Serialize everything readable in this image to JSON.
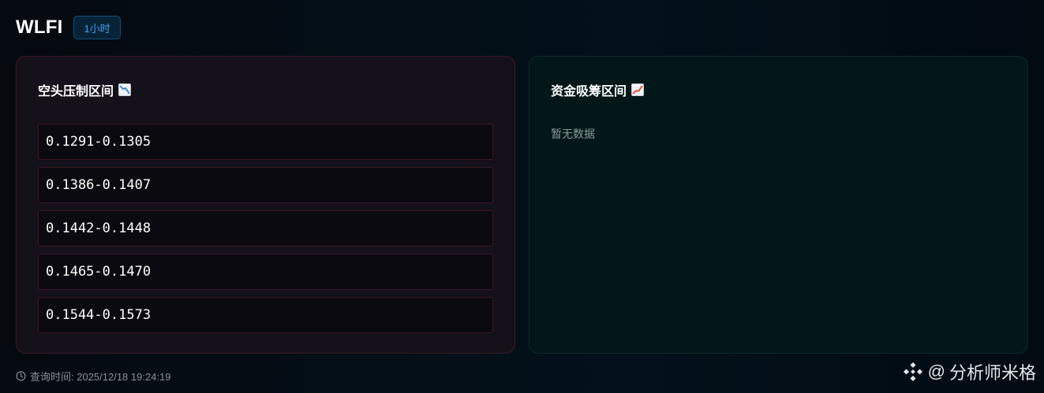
{
  "header": {
    "symbol": "WLFI",
    "timeframe": "1小时"
  },
  "short_zone": {
    "title": "空头压制区间",
    "icon": "chart-decreasing-icon",
    "ranges": [
      "0.1291-0.1305",
      "0.1386-0.1407",
      "0.1442-0.1448",
      "0.1465-0.1470",
      "0.1544-0.1573"
    ]
  },
  "long_zone": {
    "title": "资金吸筹区间",
    "icon": "chart-increasing-icon",
    "empty_text": "暂无数据"
  },
  "footer": {
    "query_time": "查询时间: 2025/12/18 19:24:19"
  },
  "watermark": {
    "at": "@",
    "author": "分析师米格"
  },
  "colors": {
    "short_border": "#3a1820",
    "timeframe_accent": "#3fa1f0"
  }
}
